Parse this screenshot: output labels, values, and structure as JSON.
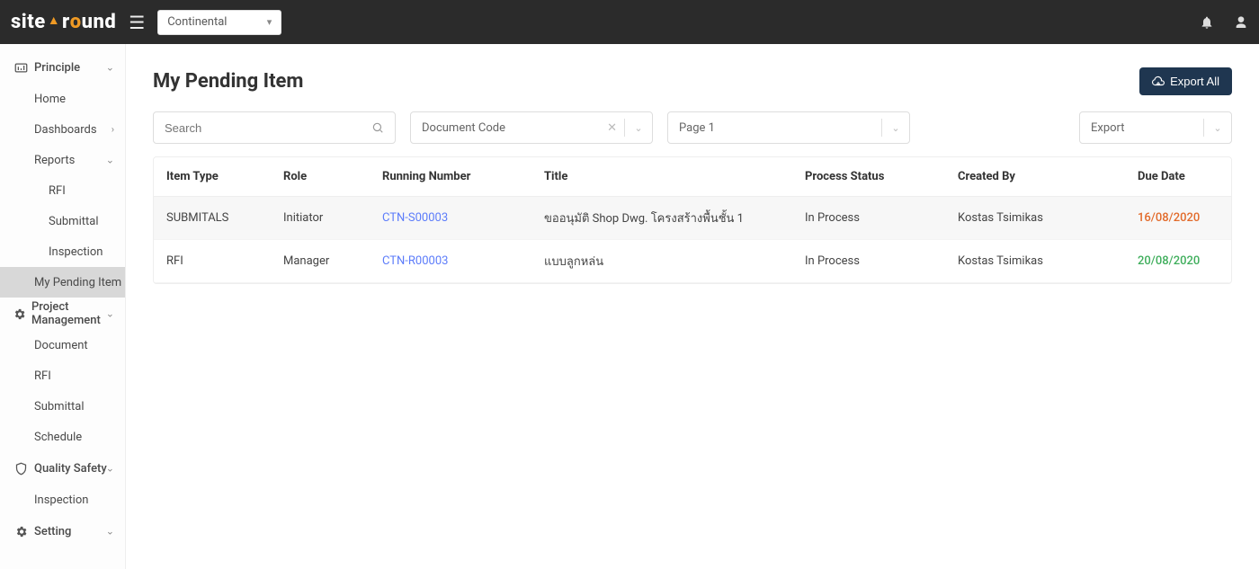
{
  "header": {
    "logo_part1": "site",
    "logo_part2": "r",
    "logo_part3": "und",
    "project_selected": "Continental"
  },
  "sidebar": {
    "principle": {
      "label": "Principle",
      "items": {
        "home": "Home",
        "dashboards": "Dashboards",
        "reports": "Reports",
        "rfi": "RFI",
        "submittal": "Submittal",
        "inspection": "Inspection",
        "pending": "My Pending Item"
      }
    },
    "pm": {
      "label": "Project Management",
      "items": {
        "document": "Document",
        "rfi": "RFI",
        "submittal": "Submittal",
        "schedule": "Schedule"
      }
    },
    "qs": {
      "label": "Quality Safety",
      "items": {
        "inspection": "Inspection"
      }
    },
    "setting": {
      "label": "Setting"
    }
  },
  "page": {
    "title": "My Pending Item",
    "export_all": "Export All"
  },
  "filters": {
    "search_placeholder": "Search",
    "doc_code": "Document Code",
    "page": "Page 1",
    "export": "Export"
  },
  "table": {
    "headers": {
      "item_type": "Item Type",
      "role": "Role",
      "running": "Running Number",
      "title": "Title",
      "status": "Process Status",
      "created_by": "Created By",
      "due": "Due Date"
    },
    "rows": [
      {
        "item_type": "SUBMITALS",
        "role": "Initiator",
        "running": "CTN-S00003",
        "title": "ขออนุมัติ Shop Dwg. โครงสร้างพื้นชั้น 1",
        "status": "In Process",
        "created_by": "Kostas Tsimikas",
        "due": "16/08/2020",
        "due_class": "due-red"
      },
      {
        "item_type": "RFI",
        "role": "Manager",
        "running": "CTN-R00003",
        "title": "แบบลูกหล่น",
        "status": "In Process",
        "created_by": "Kostas Tsimikas",
        "due": "20/08/2020",
        "due_class": "due-green"
      }
    ]
  }
}
